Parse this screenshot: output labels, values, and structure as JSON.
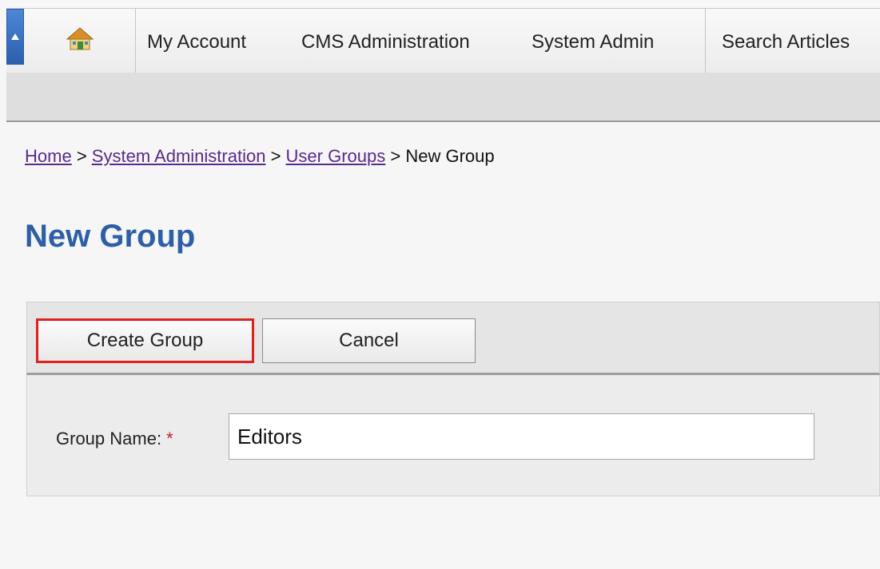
{
  "topnav": {
    "items": [
      {
        "label": "My Account"
      },
      {
        "label": "CMS Administration"
      },
      {
        "label": "System Admin"
      },
      {
        "label": "Search Articles"
      }
    ]
  },
  "breadcrumb": {
    "items": [
      "Home",
      "System Administration",
      "User Groups"
    ],
    "current": "New Group",
    "separator": ">"
  },
  "page": {
    "title": "New Group"
  },
  "toolbar": {
    "create_label": "Create Group",
    "cancel_label": "Cancel"
  },
  "form": {
    "group_name_label": "Group Name:",
    "required_marker": "*",
    "group_name_value": "Editors"
  },
  "colors": {
    "title": "#2e5fa6",
    "link": "#5a2a8a",
    "highlight": "#e01f1f",
    "required": "#c0202a"
  },
  "icons": {
    "collapse": "collapse-up-icon",
    "home": "home-icon"
  }
}
